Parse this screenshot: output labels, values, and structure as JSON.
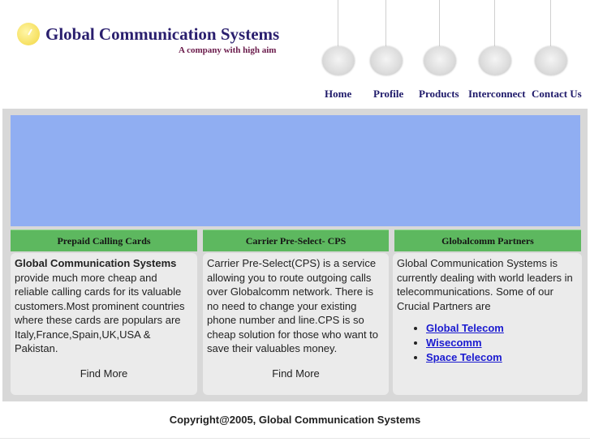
{
  "header": {
    "company_name": "Global Communication Systems",
    "tagline": "A company with high aim"
  },
  "nav": {
    "items": [
      {
        "label": "Home"
      },
      {
        "label": "Profile"
      },
      {
        "label": "Products"
      },
      {
        "label": "Interconnect"
      },
      {
        "label": "Contact Us"
      }
    ]
  },
  "columns": {
    "prepaid": {
      "heading": "Prepaid Calling Cards",
      "lead": "Global Communication Systems",
      "text": "provide much more cheap and reliable calling cards for its valuable customers.Most prominent countries where these cards are populars are Italy,France,Spain,UK,USA & Pakistan.",
      "link": "Find More"
    },
    "cps": {
      "heading": "Carrier Pre-Select- CPS",
      "text": "Carrier Pre-Select(CPS) is a service allowing you to route outgoing calls over Globalcomm network. There is no need to change your existing phone number and line.CPS is so cheap solution for those who want to save their valuables money.",
      "link": "Find More"
    },
    "partners": {
      "heading": "Globalcomm Partners",
      "text": "Global Communication Systems is currently dealing with world leaders in telecommunications. Some of our Crucial Partners are",
      "links": [
        "Global Telecom",
        "Wisecomm",
        "Space Telecom"
      ]
    }
  },
  "footer": {
    "copyright": "Copyright@2005, Global Communication Systems"
  },
  "colors": {
    "banner": "#90aef2",
    "column_header": "#5db85f",
    "nav_text": "#1f1a6a",
    "link": "#1a1ad0"
  }
}
